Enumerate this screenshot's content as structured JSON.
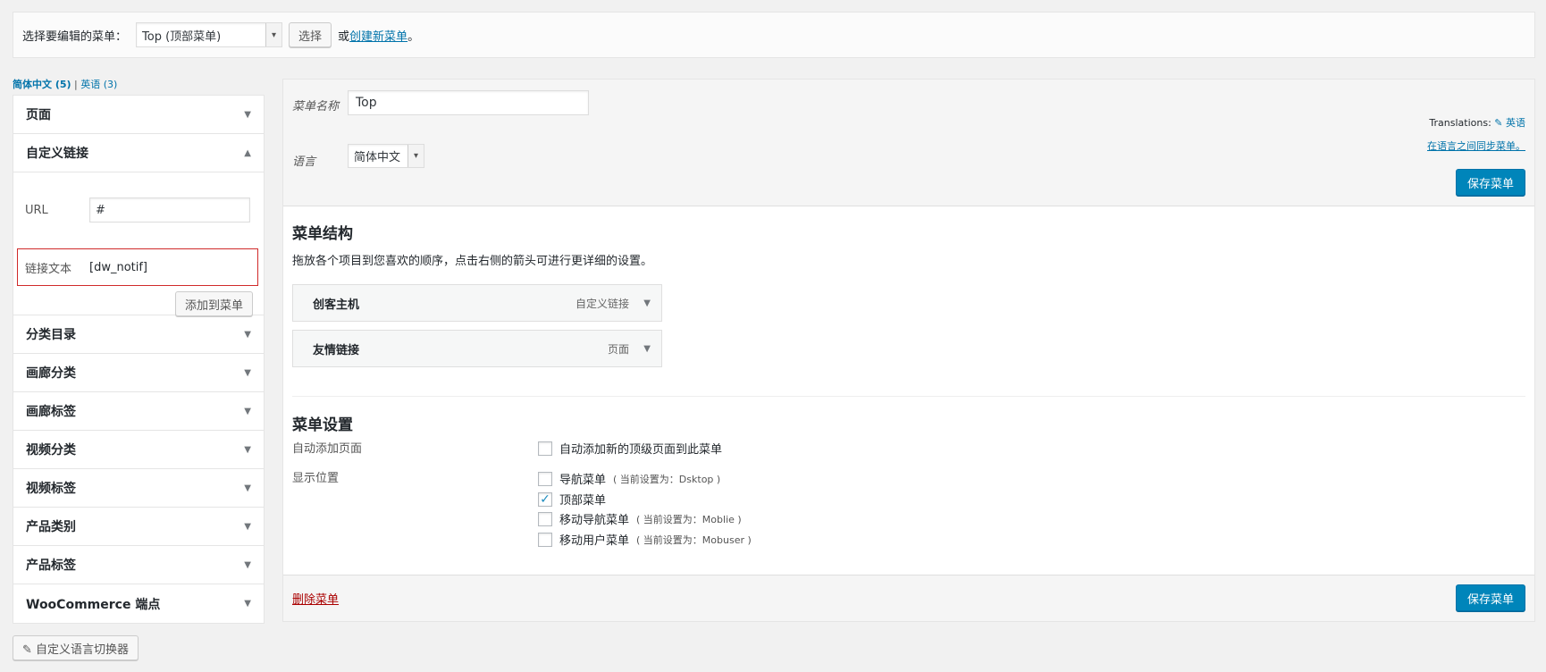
{
  "manage_bar": {
    "label": "选择要编辑的菜单：",
    "selected_menu": "Top (顶部菜单)",
    "select_button": "选择",
    "or_text": "或",
    "create_link": "创建新菜单",
    "period": "。"
  },
  "languages": {
    "current": "简体中文 (5)",
    "separator": "|",
    "other": "英语 (3)"
  },
  "accordion": {
    "items": [
      {
        "label": "页面",
        "expanded": false
      },
      {
        "label": "自定义链接",
        "expanded": true
      },
      {
        "label": "分类目录",
        "expanded": false
      },
      {
        "label": "画廊分类",
        "expanded": false
      },
      {
        "label": "画廊标签",
        "expanded": false
      },
      {
        "label": "视频分类",
        "expanded": false
      },
      {
        "label": "视频标签",
        "expanded": false
      },
      {
        "label": "产品类别",
        "expanded": false
      },
      {
        "label": "产品标签",
        "expanded": false
      },
      {
        "label": "WooCommerce 端点",
        "expanded": false
      }
    ],
    "custom_link": {
      "url_label": "URL",
      "url_value": "#",
      "text_label": "链接文本",
      "text_value": "[dw_notif]",
      "add_button": "添加到菜单"
    }
  },
  "menu_header": {
    "name_label": "菜单名称",
    "name_value": "Top",
    "lang_label": "语言",
    "lang_value": "简体中文",
    "translations_label": "Translations:",
    "translations_link": "✎ 英语",
    "sync_link": "在语言之间同步菜单。",
    "save_button": "保存菜单"
  },
  "structure": {
    "title": "菜单结构",
    "description": "拖放各个项目到您喜欢的顺序，点击右侧的箭头可进行更详细的设置。",
    "items": [
      {
        "title": "创客主机",
        "type": "自定义链接"
      },
      {
        "title": "友情链接",
        "type": "页面"
      }
    ]
  },
  "settings": {
    "title": "菜单设置",
    "auto_add_label": "自动添加页面",
    "auto_add_option": "自动添加新的顶级页面到此菜单",
    "auto_add_checked": false,
    "location_label": "显示位置",
    "locations": [
      {
        "label": "导航菜单",
        "note": "( 当前设置为：Dsktop )",
        "checked": false
      },
      {
        "label": "顶部菜单",
        "note": "",
        "checked": true
      },
      {
        "label": "移动导航菜单",
        "note": "( 当前设置为：Moblie )",
        "checked": false
      },
      {
        "label": "移动用户菜单",
        "note": "( 当前设置为：Mobuser )",
        "checked": false
      }
    ]
  },
  "footer": {
    "delete_link": "删除菜单",
    "save_button": "保存菜单"
  },
  "lang_switcher_button": "✎ 自定义语言切换器",
  "colors": {
    "primary": "#0085ba",
    "link": "#0073aa",
    "danger": "#a00",
    "highlight_border": "#d02a2a"
  }
}
